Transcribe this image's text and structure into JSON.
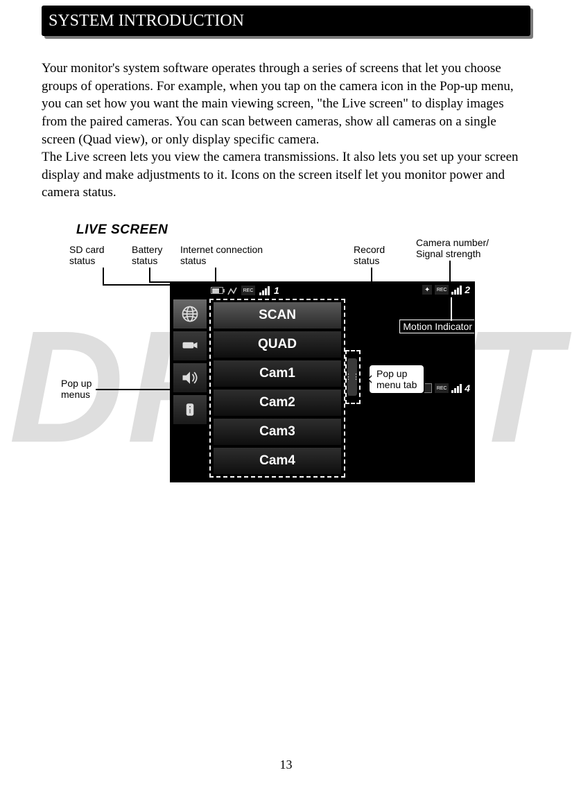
{
  "watermark": "DRAFT",
  "header": {
    "title": "SYSTEM INTRODUCTION"
  },
  "body": {
    "p1": "Your monitor's system software operates through a series of screens that let you choose groups of operations. For example, when you tap on the camera icon in the Pop-up menu, you can set how you want the main viewing screen, \"the Live screen\" to display images from the paired cameras. You can scan between cameras, show all cameras on a single screen (Quad view), or only display specific camera.",
    "p2": "The Live screen lets you view the camera transmissions. It also lets you set up your screen display and make adjustments to it. Icons on the screen itself let you monitor power and camera status."
  },
  "figure": {
    "title": "LIVE SCREEN",
    "callouts": {
      "sd": "SD card\nstatus",
      "battery": "Battery\nstatus",
      "internet": "Internet connection\nstatus",
      "record": "Record\nstatus",
      "camnum": "Camera number/\nSignal strength",
      "motion": "Motion Indicator",
      "popup_side": "Pop up\nmenus",
      "popup_tab": "Pop up\nmenu tab"
    },
    "status": {
      "cam_top": "1",
      "cam_right": "2",
      "cam_bottom": "4"
    },
    "menu": [
      "SCAN",
      "QUAD",
      "Cam1",
      "Cam2",
      "Cam3",
      "Cam4"
    ]
  },
  "page_number": "13"
}
